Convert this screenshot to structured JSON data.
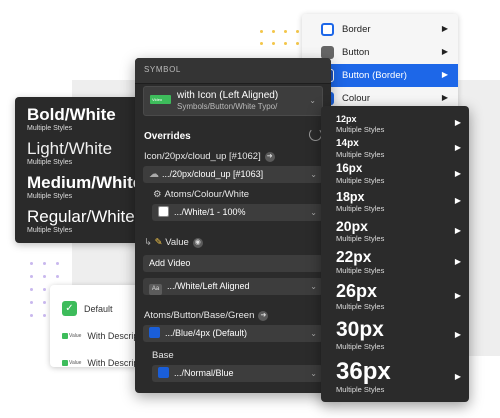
{
  "text_styles": [
    {
      "name": "Bold/White",
      "sub": "Multiple Styles"
    },
    {
      "name": "Light/White",
      "sub": "Multiple Styles"
    },
    {
      "name": "Medium/White",
      "sub": "Multiple Styles"
    },
    {
      "name": "Regular/White",
      "sub": "Multiple Styles"
    }
  ],
  "checkbox_card": {
    "default_label": "Default",
    "check_glyph": "✓",
    "rows": [
      {
        "chip": "Value",
        "label": "With Description"
      },
      {
        "chip": "Value",
        "label": "With Description"
      }
    ]
  },
  "symbol_panel": {
    "header": "SYMBOL",
    "symbol_title": "with Icon (Left Aligned)",
    "symbol_path": "Symbols/Button/White Typo/",
    "thumb_label": "Video",
    "overrides_label": "Overrides",
    "icon_override_label": "Icon/20px/cloud_up [#1062]",
    "icon_override_value": ".../20px/cloud_up [#1063]",
    "colour_label": "Atoms/Colour/White",
    "colour_value": ".../White/1 - 100%",
    "value_label": "Value",
    "value_text": "Add Video",
    "text_style_value": ".../White/Left Aligned",
    "aa_glyph": "Aa",
    "base_label": "Atoms/Button/Base/Green",
    "base_value": ".../Blue/4px (Default)",
    "base2_label": "Base",
    "base2_value": ".../Normal/Blue",
    "go_glyph": "➜",
    "chevron": "⌄"
  },
  "menu_top": {
    "items": [
      {
        "label": "Border",
        "icon": "border-icon",
        "selected": false
      },
      {
        "label": "Button",
        "icon": "button-icon",
        "selected": false
      },
      {
        "label": "Button (Border)",
        "icon": "button-border-icon",
        "selected": true
      },
      {
        "label": "Colour",
        "icon": "colour-icon",
        "selected": false
      }
    ],
    "arrow": "▶"
  },
  "size_menu": {
    "items": [
      {
        "name": "12px",
        "sub": "Multiple Styles"
      },
      {
        "name": "14px",
        "sub": "Multiple Styles"
      },
      {
        "name": "16px",
        "sub": "Multiple Styles"
      },
      {
        "name": "18px",
        "sub": "Multiple Styles"
      },
      {
        "name": "20px",
        "sub": "Multiple Styles"
      },
      {
        "name": "22px",
        "sub": "Multiple Styles"
      },
      {
        "name": "26px",
        "sub": "Multiple Styles"
      },
      {
        "name": "30px",
        "sub": "Multiple Styles"
      },
      {
        "name": "36px",
        "sub": "Multiple Styles"
      }
    ],
    "arrow": "▶"
  },
  "colors": {
    "panel": "#2b2b2b",
    "accent_blue": "#1d67e8",
    "swatch_blue": "#1a5ed8",
    "green": "#3dbc5b",
    "dot_yellow": "#f3c64a",
    "dot_purple": "#c9b8ee"
  }
}
